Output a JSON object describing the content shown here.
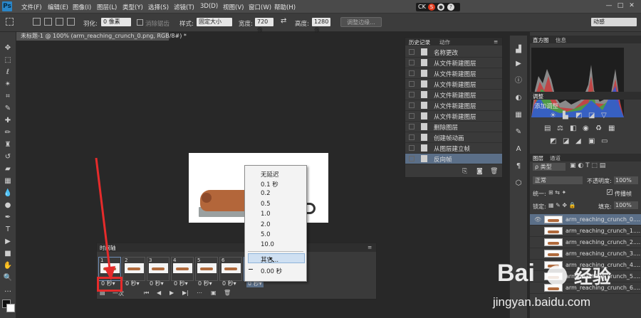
{
  "app": {
    "logo": "Ps"
  },
  "menubar": {
    "items": [
      "文件(F)",
      "编辑(E)",
      "图像(I)",
      "图层(L)",
      "类型(Y)",
      "选择(S)",
      "滤镜(T)",
      "3D(D)",
      "视图(V)",
      "窗口(W)",
      "帮助(H)"
    ],
    "ime": {
      "label": "CK",
      "badge": "S"
    },
    "window_controls": [
      "—",
      "□",
      "✕"
    ]
  },
  "options": {
    "feather_label": "羽化:",
    "feather_value": "0 像素",
    "antialias_label": "消除锯齿",
    "style_label": "样式:",
    "style_value": "固定大小",
    "width_label": "宽度:",
    "width_value": "720 像",
    "height_label": "高度:",
    "height_value": "1280 像",
    "refine_button": "调整边缘...",
    "workspace": "动感"
  },
  "document": {
    "tab_title": "未标题-1 @ 100% (arm_reaching_crunch_0.png, RGB/8#) *"
  },
  "history_panel": {
    "tabs": [
      "历史记录",
      "动作"
    ],
    "items": [
      "名称更改",
      "从文件新建图层",
      "从文件新建图层",
      "从文件新建图层",
      "从文件新建图层",
      "从文件新建图层",
      "从文件新建图层",
      "删除图层",
      "创建帧动画",
      "从图层建立帧",
      "反向帧"
    ]
  },
  "right_panels": {
    "histogram_tabs": [
      "直方图",
      "信息"
    ],
    "adjust_tabs": [
      "调整"
    ],
    "adjust_title": "添加调整",
    "layers_tabs": [
      "图层",
      "通道"
    ],
    "kind_filter": "ρ 类型",
    "blend_mode": "正常",
    "opacity_label": "不透明度:",
    "opacity_value": "100%",
    "unify_label": "统一:",
    "propagate_label": "传播帧",
    "lock_label": "锁定:",
    "fill_label": "填充:",
    "fill_value": "100%",
    "layers": [
      "arm_reaching_crunch_0....",
      "arm_reaching_crunch_1....",
      "arm_reaching_crunch_2....",
      "arm_reaching_crunch_3....",
      "arm_reaching_crunch_4....",
      "arm_reaching_crunch_5....",
      "arm_reaching_crunch_6...."
    ]
  },
  "timeline": {
    "tab": "时间轴",
    "frames": [
      {
        "num": "1",
        "delay": "0 秒▾"
      },
      {
        "num": "2",
        "delay": "0 秒▾"
      },
      {
        "num": "3",
        "delay": "0 秒▾"
      },
      {
        "num": "4",
        "delay": "0 秒▾"
      },
      {
        "num": "5",
        "delay": "0 秒▾"
      },
      {
        "num": "6",
        "delay": "0 秒▾"
      },
      {
        "num": "",
        "delay": "0 秒▾"
      }
    ],
    "loop": "一次"
  },
  "delay_menu": {
    "items": [
      "无延迟",
      "0.1 秒",
      "0.2",
      "0.5",
      "1.0",
      "2.0",
      "5.0",
      "10.0"
    ],
    "other": "其它...",
    "current": "0.00 秒"
  },
  "watermark": {
    "brand": "Bai",
    "brand_cn": "经验",
    "url": "jingyan.baidu.com"
  },
  "colors": {
    "highlight": "#e62b2b",
    "accent": "#2a86c8"
  }
}
